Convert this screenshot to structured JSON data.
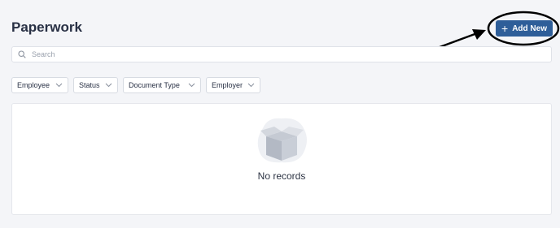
{
  "header": {
    "title": "Paperwork",
    "add_button_label": "Add New",
    "add_button_icon": "plus-icon",
    "accent_color": "#2e5e99"
  },
  "search": {
    "placeholder": "Search",
    "value": "",
    "icon": "search-icon"
  },
  "filters": [
    {
      "label": "Employee"
    },
    {
      "label": "Status"
    },
    {
      "label": "Document Type"
    },
    {
      "label": "Employer"
    }
  ],
  "results": {
    "empty_message": "No records",
    "illustration": "empty-box-illustration"
  },
  "annotation": {
    "type": "circle-with-arrow",
    "target": "add-new-button",
    "color": "#000000"
  }
}
